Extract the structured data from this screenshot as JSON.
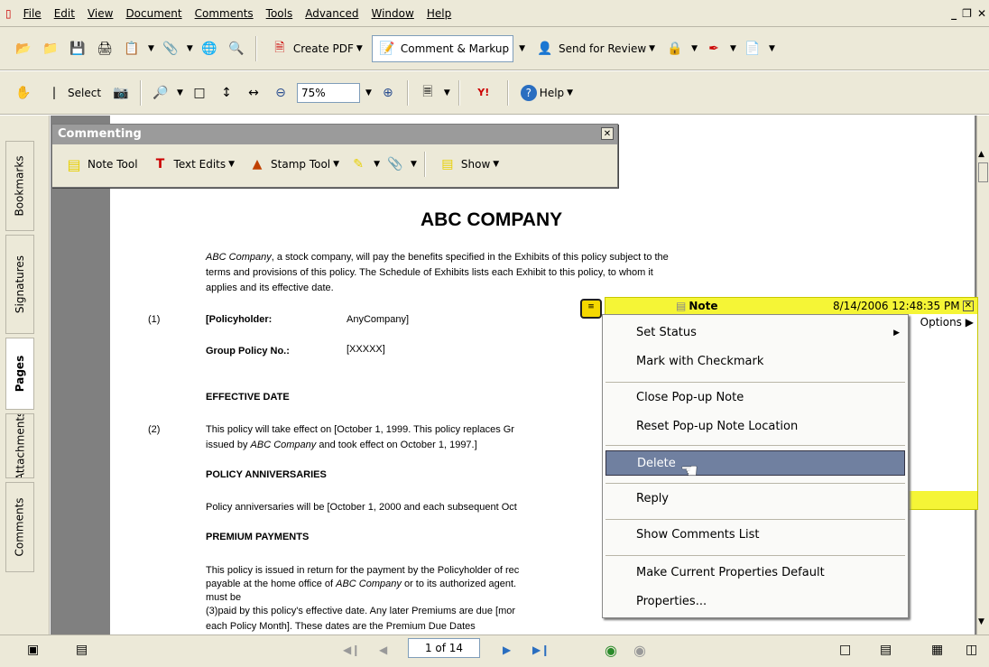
{
  "menubar": {
    "items": [
      "File",
      "Edit",
      "View",
      "Document",
      "Comments",
      "Tools",
      "Advanced",
      "Window",
      "Help"
    ]
  },
  "toolbar1": {
    "create_pdf": "Create PDF",
    "comment_markup": "Comment & Markup",
    "send_for_review": "Send for Review"
  },
  "toolbar2": {
    "select": "Select",
    "zoom": "75%",
    "help": "Help"
  },
  "sidebar": {
    "tabs": [
      "Bookmarks",
      "Signatures",
      "Pages",
      "Attachments",
      "Comments"
    ]
  },
  "commenting": {
    "title": "Commenting",
    "note_tool": "Note Tool",
    "text_edits": "Text Edits",
    "stamp_tool": "Stamp Tool",
    "show": "Show"
  },
  "document": {
    "title": "ABC COMPANY",
    "intro_italic": "ABC Company",
    "intro_line1": ", a stock company, will pay the benefits specified in the Exhibits of this policy subject to the",
    "intro_line2": "terms and provisions of this policy.  The Schedule of Exhibits lists each Exhibit to this policy, to whom it",
    "intro_line3": "applies and its effective date.",
    "num1": "(1)",
    "policyholder_label": "[Policyholder:",
    "policyholder_value": "AnyCompany]",
    "group_label": "Group Policy No.:",
    "group_value": "[XXXXX]",
    "effective_heading": "EFFECTIVE DATE",
    "num2": "(2)",
    "effective_line1": "This policy will take effect on [October 1, 1999.  This policy replaces Gr",
    "effective_line2_pre": "issued by ",
    "effective_line2_italic": "ABC Company",
    "effective_line2_post": " and took effect on October 1, 1997.]",
    "anniv_heading": "POLICY ANNIVERSARIES",
    "anniv_line": "Policy anniversaries will be [October 1, 2000 and each subsequent Oct",
    "premium_heading": "PREMIUM PAYMENTS",
    "premium_line1": "This policy is issued in return for the payment by the Policyholder of rec",
    "premium_line2_pre": "payable at the home office of ",
    "premium_line2_italic": "ABC Company",
    "premium_line2_post": " or to its authorized agent.",
    "premium_line3": "must be",
    "premium_line4": "(3)paid by this policy's effective date.  Any later Premiums are due [mor",
    "premium_line5": "each Policy Month]. These dates are the Premium Due Dates"
  },
  "note": {
    "title": "Note",
    "timestamp": "8/14/2006 12:48:35 PM",
    "options": "Options"
  },
  "context_menu": {
    "set_status": "Set Status",
    "mark_checkmark": "Mark with Checkmark",
    "close_popup": "Close Pop-up Note",
    "reset_popup": "Reset Pop-up Note Location",
    "delete": "Delete",
    "reply": "Reply",
    "show_comments": "Show Comments List",
    "make_default": "Make Current Properties Default",
    "properties": "Properties..."
  },
  "statusbar": {
    "page": "1 of 14"
  }
}
